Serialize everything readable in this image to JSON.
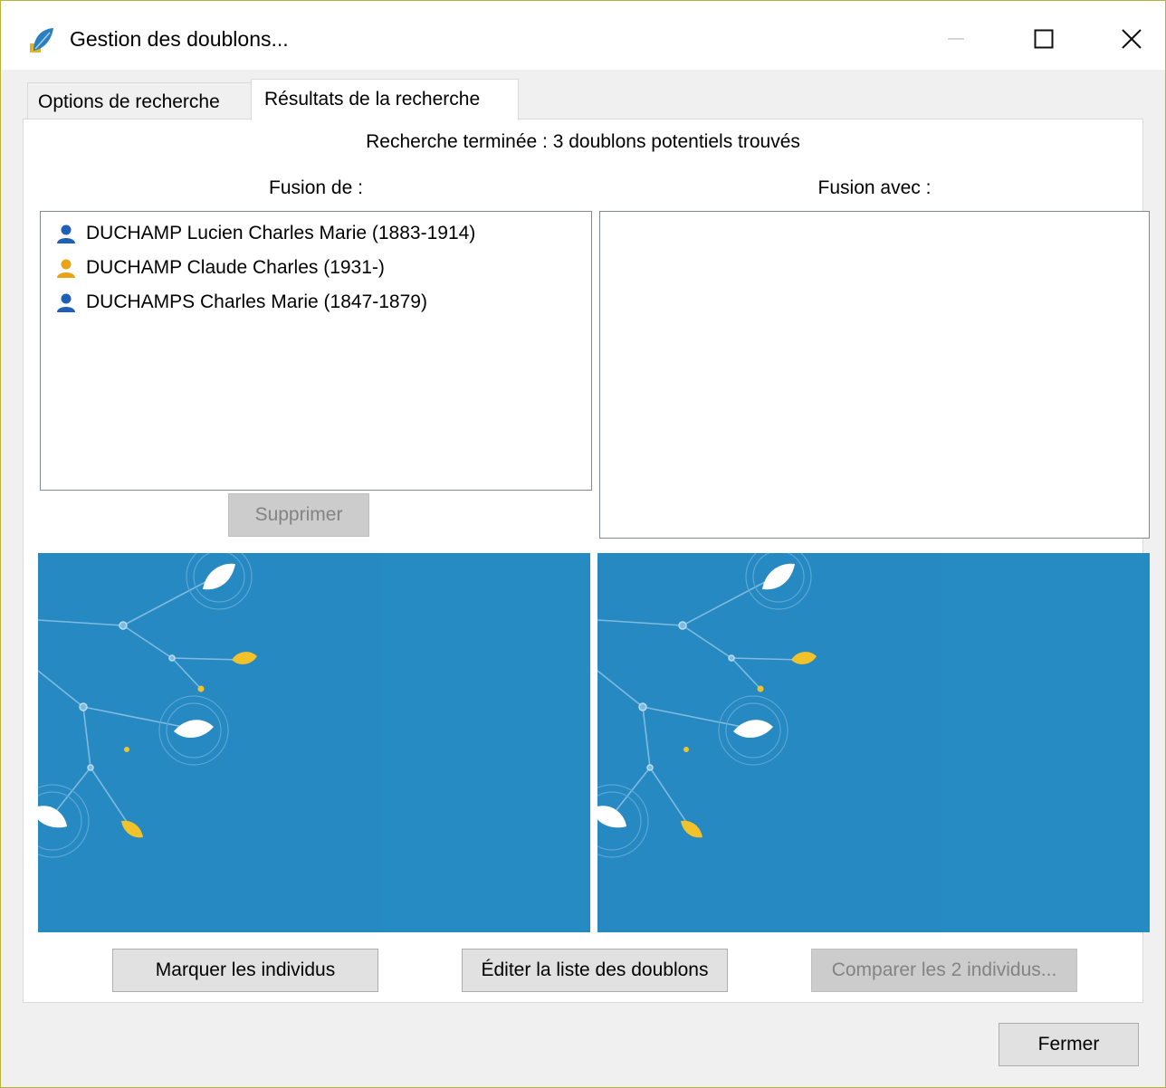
{
  "window": {
    "title": "Gestion des doublons..."
  },
  "tabs": [
    {
      "label": "Options de recherche"
    },
    {
      "label": "Résultats de la recherche"
    }
  ],
  "results": {
    "status": "Recherche terminée : 3 doublons potentiels trouvés",
    "fusion_de_label": "Fusion de :",
    "fusion_avec_label": "Fusion avec :",
    "fusion_de_items": [
      {
        "name": "DUCHAMP Lucien Charles Marie (1883-1914)",
        "icon": "male-person-icon",
        "color": "#1f5fb5"
      },
      {
        "name": "DUCHAMP Claude Charles (1931-)",
        "icon": "female-person-icon",
        "color": "#e8a317"
      },
      {
        "name": "DUCHAMPS Charles Marie (1847-1879)",
        "icon": "male-person-icon",
        "color": "#1f5fb5"
      }
    ],
    "fusion_avec_items": [],
    "supprimer_label": "Supprimer",
    "preview_color": "#2689c2"
  },
  "buttons": {
    "marquer": "Marquer les individus",
    "editer": "Éditer la liste des doublons",
    "comparer": "Comparer les 2 individus...",
    "fermer": "Fermer"
  }
}
